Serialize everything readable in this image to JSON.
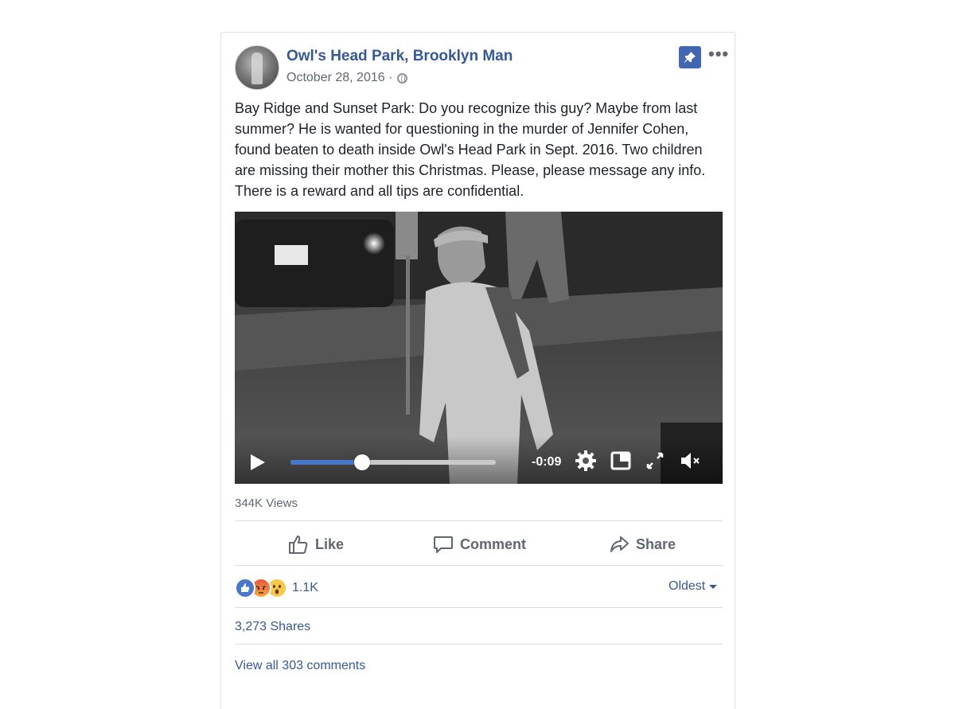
{
  "post": {
    "page_name": "Owl's Head Park, Brooklyn Man",
    "date": "October 28, 2016 ·",
    "text": "Bay Ridge and Sunset Park: Do you recognize this guy? Maybe from last summer? He is wanted for questioning in the murder of Jennifer Cohen, found beaten to death inside Owl's Head Park in Sept. 2016. Two children are missing their mother this Christmas. Please, please message any info. There is a reward and all tips are confidential.",
    "more_label": "•••"
  },
  "video": {
    "time_remaining": "-0:09",
    "progress": 0.35,
    "muted": true
  },
  "stats": {
    "views": "344K Views",
    "reaction_count": "1.1K",
    "reactions": [
      "like",
      "angry",
      "wow"
    ],
    "shares": "3,273 Shares",
    "view_comments": "View all 303 comments"
  },
  "actions": {
    "like": "Like",
    "comment": "Comment",
    "share": "Share"
  },
  "sort": {
    "label": "Oldest"
  },
  "colors": {
    "link": "#365899",
    "accent": "#4267b2",
    "muted_text": "#606770"
  }
}
